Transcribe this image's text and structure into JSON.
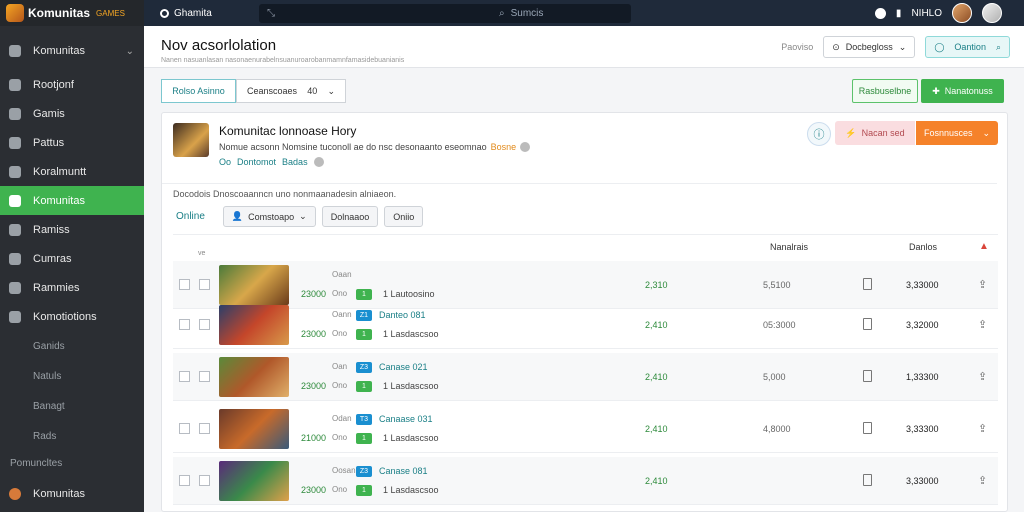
{
  "brand": {
    "name": "Komunitas",
    "sub": "GAMES"
  },
  "sidebar": {
    "items": [
      {
        "label": "Komunitas",
        "icon": "home-icon",
        "chevron": "⌄",
        "active": false
      },
      {
        "label": "Rootjonf",
        "icon": "profile-icon",
        "active": false
      },
      {
        "label": "Gamis",
        "icon": "gamepad-icon",
        "active": false
      },
      {
        "label": "Pattus",
        "icon": "tag-icon",
        "active": false
      },
      {
        "label": "Koralmuntt",
        "icon": "chart-icon",
        "active": false
      },
      {
        "label": "Komunitas",
        "icon": "people-icon",
        "active": true
      },
      {
        "label": "Ramiss",
        "icon": "list-icon",
        "active": false
      },
      {
        "label": "Cumras",
        "icon": "file-icon",
        "active": false
      },
      {
        "label": "Rammies",
        "icon": "grid-icon",
        "active": false
      },
      {
        "label": "Komotiotions",
        "icon": "wrench-icon",
        "active": false
      }
    ],
    "subitems": [
      "Ganids",
      "Natuls",
      "Banagt",
      "Rads"
    ],
    "section_label": "Pomuncltes",
    "footer": {
      "label": "Komunitas",
      "icon": "user-icon"
    }
  },
  "topbar": {
    "brand_label": "Ghamita",
    "search_placeholder": "Sumcis",
    "right_label": "NIHLO"
  },
  "header": {
    "title": "Nov acsorlolation",
    "subtitle": "Nanen nasuanlasan nasonaenurabelnsuanuroarobanmamnfamasidebuanianis",
    "right_label": "Paoviso",
    "select_label": "Docbegloss",
    "teal_label": "Oantion"
  },
  "filters": {
    "tab_active": "Rolso Asinno",
    "tab_dropdown": "Ceanscoaes",
    "tab_dropdown_value": "40"
  },
  "actions": {
    "outline_green": "Rasbuselbne",
    "green": "Nanatonuss"
  },
  "card": {
    "title": "Komunitac lonnoase Hory",
    "desc": "Nomue acsonn Nomsine tuconoll ae do nsc desonaanto eseomnao",
    "tag": "Bosne",
    "meta_a": "Oo",
    "meta_b": "Dontomot",
    "meta_c": "Badas",
    "pink_btn": "Nacan sed",
    "orange_btn": "Fosnnusces",
    "caption": "Docodois Dnoscoaanncn uno nonmaanadesin alniaeon.",
    "online": "Online",
    "chip_user": "Comstoapo",
    "chip_a": "Dolnaaoo",
    "chip_b": "Oniio"
  },
  "table": {
    "headers": {
      "col_mid": "Nanalrais",
      "col_total": "Danlos"
    },
    "header_mini": "ve",
    "rows": [
      {
        "price": "23000",
        "small1": "Oaan",
        "small2": "Ono",
        "badge2": "1",
        "label1": "",
        "label2": "1 Lautoosino",
        "value": "2,310",
        "mid": "5,5100",
        "total": "3,33000"
      },
      {
        "price": "23000",
        "small1": "Oann",
        "small2": "Ono",
        "badge1": "Z1",
        "badge2": "1",
        "label1": "Danteo 081",
        "label2": "1 Lasdascsoo",
        "value": "2,410",
        "mid": "05:3000",
        "total": "3,32000"
      },
      {
        "price": "23000",
        "small1": "Oan",
        "small2": "Ono",
        "badge1": "Z3",
        "badge2": "1",
        "label1": "Canase 021",
        "label2": "1 Lasdascsoo",
        "value": "2,410",
        "mid": "5,000",
        "total": "1,33300"
      },
      {
        "price": "21000",
        "small1": "Odan",
        "small2": "Ono",
        "badge1": "T3",
        "badge2": "1",
        "label1": "Canaase 031",
        "label2": "1 Lasdascsoo",
        "value": "2,410",
        "mid": "4,8000",
        "total": "3,33300"
      },
      {
        "price": "23000",
        "small1": "Oosan",
        "small2": "Ono",
        "badge1": "Z3",
        "badge2": "1",
        "label1": "Canase 081",
        "label2": "1 Lasdascsoo",
        "value": "2,410",
        "mid": "",
        "total": "3,33000"
      }
    ]
  },
  "colors": {
    "sidebar_bg": "#2b2e33",
    "topbar_bg": "#1f2a3a",
    "accent_green": "#3fb34f",
    "accent_orange": "#f5822a",
    "accent_teal": "#1a7f86"
  }
}
